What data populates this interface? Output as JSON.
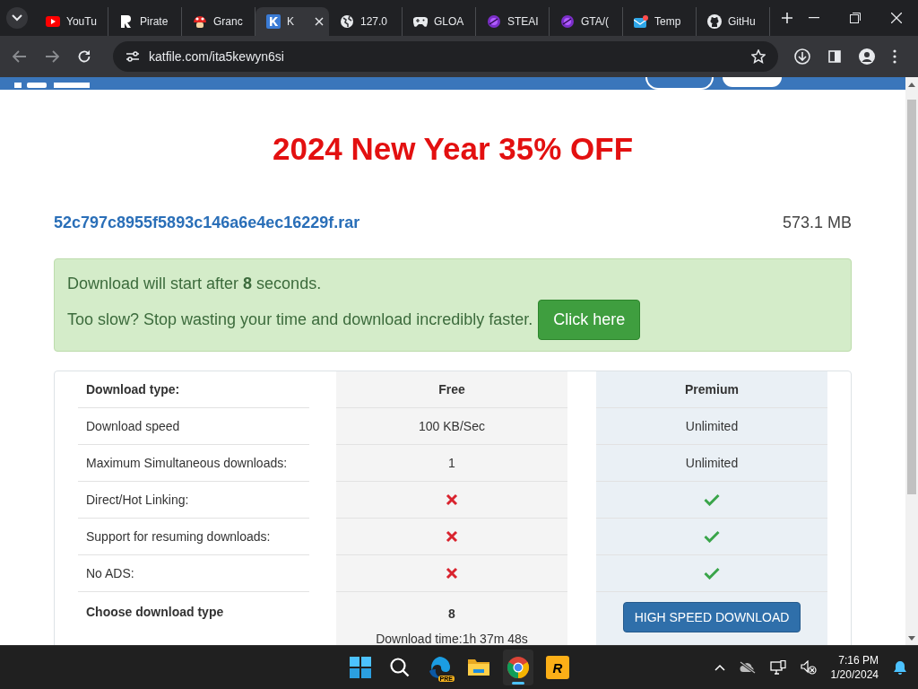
{
  "browser": {
    "tabs": [
      {
        "label": "YouTu",
        "kind": "youtube",
        "selected": false
      },
      {
        "label": "Pirate",
        "kind": "rlogo",
        "selected": false
      },
      {
        "label": "Granc",
        "kind": "mushroom",
        "selected": false
      },
      {
        "label": "K",
        "kind": "klogo",
        "selected": true
      },
      {
        "label": "127.0",
        "kind": "globe",
        "selected": false
      },
      {
        "label": "GLOA",
        "kind": "gamepad",
        "selected": false
      },
      {
        "label": "STEAI",
        "kind": "orb",
        "selected": false
      },
      {
        "label": "GTA/(",
        "kind": "orb",
        "selected": false
      },
      {
        "label": "Temp",
        "kind": "mail",
        "selected": false
      },
      {
        "label": "GitHu",
        "kind": "github",
        "selected": false
      }
    ],
    "address": "katfile.com/ita5kewyn6si"
  },
  "page": {
    "promo": "2024 New Year 35% OFF",
    "file_name": "52c797c8955f5893c146a6e4ec16229f.rar",
    "file_size": "573.1 MB",
    "notice": {
      "countdown": "Download will start after **8** seconds.",
      "upsell": "Too slow? Stop wasting your time and download incredibly faster.",
      "button": "Click here"
    },
    "comparison": {
      "columns": [
        "Download type:",
        "Free",
        "Premium"
      ],
      "rows": [
        {
          "label": "Download speed",
          "free": {
            "kind": "text",
            "text": "100 KB/Sec"
          },
          "premium": {
            "kind": "text",
            "text": "Unlimited"
          }
        },
        {
          "label": "Maximum Simultaneous downloads:",
          "free": {
            "kind": "text",
            "text": "1"
          },
          "premium": {
            "kind": "text",
            "text": "Unlimited"
          }
        },
        {
          "label": "Direct/Hot Linking:",
          "free": {
            "kind": "cross"
          },
          "premium": {
            "kind": "check"
          }
        },
        {
          "label": "Support for resuming downloads:",
          "free": {
            "kind": "cross"
          },
          "premium": {
            "kind": "check"
          }
        },
        {
          "label": "No ADS:",
          "free": {
            "kind": "cross"
          },
          "premium": {
            "kind": "check"
          }
        }
      ],
      "choose": {
        "label": "Choose download type",
        "free_count": "8",
        "free_time": "Download time:1h 37m 48s",
        "premium_button": "HIGH SPEED DOWNLOAD"
      }
    }
  },
  "taskbar": {
    "apps": [
      {
        "kind": "start",
        "active": false
      },
      {
        "kind": "search",
        "active": false
      },
      {
        "kind": "edge",
        "badge": "PRE",
        "active": false
      },
      {
        "kind": "folder",
        "active": false
      },
      {
        "kind": "chrome",
        "active": true
      },
      {
        "kind": "rockstar",
        "mark": "R",
        "active": false
      }
    ],
    "time": "7:16 PM",
    "date": "1/20/2024"
  }
}
